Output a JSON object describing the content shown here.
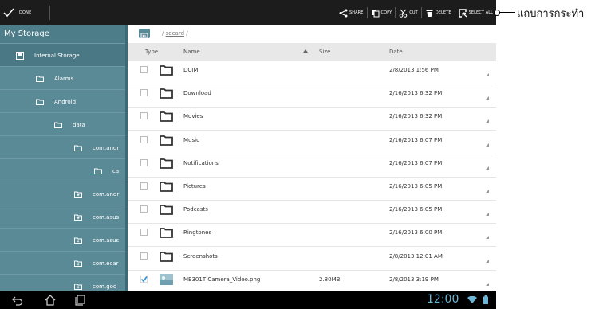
{
  "actionbar": {
    "done": "DONE",
    "actions": [
      {
        "label": "SHARE",
        "icon": "share-icon"
      },
      {
        "label": "COPY",
        "icon": "copy-icon"
      },
      {
        "label": "CUT",
        "icon": "cut-icon"
      },
      {
        "label": "DELETE",
        "icon": "delete-icon"
      },
      {
        "label": "SELECT ALL",
        "icon": "select-all-icon"
      }
    ]
  },
  "sidebar": {
    "title": "My Storage",
    "items": [
      {
        "label": "Internal Storage",
        "icon": "storage-icon"
      },
      {
        "label": "Alarms",
        "icon": "folder-icon"
      },
      {
        "label": "Android",
        "icon": "folder-icon"
      },
      {
        "label": "data",
        "icon": "folder-icon"
      },
      {
        "label": "com.andr",
        "icon": "folder-icon"
      },
      {
        "label": "ca",
        "icon": "folder-icon"
      },
      {
        "label": "com.andr",
        "icon": "folder-plus-icon"
      },
      {
        "label": "com.asus",
        "icon": "folder-plus-icon"
      },
      {
        "label": "com.asus",
        "icon": "folder-plus-icon"
      },
      {
        "label": "com.ecar",
        "icon": "folder-plus-icon"
      },
      {
        "label": "com.goo",
        "icon": "folder-plus-icon"
      }
    ]
  },
  "path": {
    "prefix": "/",
    "folder": "sdcard",
    "suffix": "/"
  },
  "columns": {
    "type": "Type",
    "name": "Name",
    "size": "Size",
    "date": "Date"
  },
  "files": [
    {
      "name": "DCIM",
      "size": "",
      "date": "2/8/2013 1:56 PM",
      "checked": false,
      "kind": "folder"
    },
    {
      "name": "Download",
      "size": "",
      "date": "2/16/2013 6:32 PM",
      "checked": false,
      "kind": "folder"
    },
    {
      "name": "Movies",
      "size": "",
      "date": "2/16/2013 6:32 PM",
      "checked": false,
      "kind": "folder"
    },
    {
      "name": "Music",
      "size": "",
      "date": "2/16/2013 6:07 PM",
      "checked": false,
      "kind": "folder"
    },
    {
      "name": "Notifications",
      "size": "",
      "date": "2/16/2013 6:07 PM",
      "checked": false,
      "kind": "folder"
    },
    {
      "name": "Pictures",
      "size": "",
      "date": "2/16/2013 6:05 PM",
      "checked": false,
      "kind": "folder"
    },
    {
      "name": "Podcasts",
      "size": "",
      "date": "2/16/2013 6:05 PM",
      "checked": false,
      "kind": "folder"
    },
    {
      "name": "Ringtones",
      "size": "",
      "date": "2/16/2013 6:00 PM",
      "checked": false,
      "kind": "folder"
    },
    {
      "name": "Screenshots",
      "size": "",
      "date": "2/8/2013 12:01 AM",
      "checked": false,
      "kind": "folder"
    },
    {
      "name": "ME301T Camera_Video.png",
      "size": "2.80MB",
      "date": "2/8/2013 3:19 PM",
      "checked": true,
      "kind": "image"
    }
  ],
  "statusbar": {
    "clock": "12:00"
  },
  "callout": {
    "text": "แถบการกระทำ"
  },
  "colors": {
    "sidebar": "#5b8a97",
    "actionbar": "#1c1c1c",
    "clock": "#6bb6d6"
  }
}
